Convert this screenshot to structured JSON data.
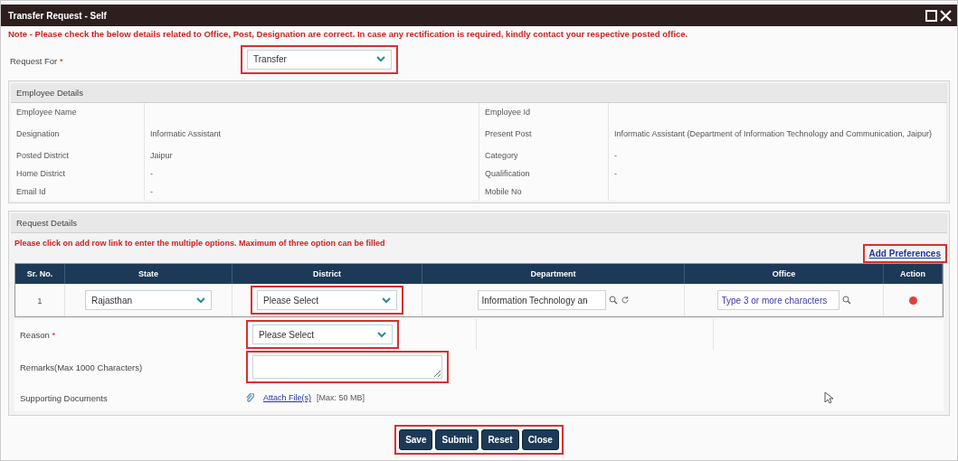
{
  "window": {
    "title": "Transfer Request - Self"
  },
  "note": "Note - Please check the below details related to Office, Post, Designation are correct. In case any rectification is required, kindly contact your respective posted office.",
  "request_for": {
    "label": "Request For",
    "required": true,
    "required_mark": "*",
    "value": "Transfer",
    "highlighted": true
  },
  "employee_details": {
    "title": "Employee Details",
    "rows": [
      {
        "left": {
          "label": "Employee Name"
        },
        "right": {
          "label": "Employee Id"
        }
      },
      {
        "left": {
          "label": "Designation",
          "value": "Informatic Assistant"
        },
        "right": {
          "label": "Present Post",
          "value": "Informatic Assistant (Department of Information Technology and Communication, Jaipur)"
        }
      },
      {
        "left": {
          "label": "Posted District",
          "value": "Jaipur"
        },
        "right": {
          "label": "Category",
          "value": "-"
        }
      },
      {
        "left": {
          "label": "Home District",
          "value": "-"
        },
        "right": {
          "label": "Qualification",
          "value": "-"
        }
      },
      {
        "left": {
          "label": "Email Id",
          "value": "-"
        },
        "right": {
          "label": "Mobile No"
        }
      }
    ]
  },
  "request_details": {
    "title": "Request Details",
    "instruction": "Please click on add row link to enter the multiple options. Maximum of three option can be filled",
    "add_link": {
      "label": "Add Preferences",
      "highlighted": true
    },
    "columns": [
      "Sr. No.",
      "State",
      "District",
      "Department",
      "Office",
      "Action"
    ],
    "rows": [
      {
        "sr": "1",
        "state": "Rajasthan",
        "district": {
          "value": "Please Select",
          "highlighted": true
        },
        "department": "Information Technology an",
        "office_placeholder": "Type 3 or more characters"
      }
    ]
  },
  "reason": {
    "label": "Reason",
    "required": true,
    "required_mark": "*",
    "value": "Please Select",
    "highlighted": true
  },
  "remarks": {
    "label": "Remarks(Max 1000 Characters)",
    "highlighted": true
  },
  "documents": {
    "label": "Supporting Documents",
    "link": "Attach File(s)",
    "limit": "[Max: 50 MB]"
  },
  "buttons": [
    "Save",
    "Submit",
    "Reset",
    "Close"
  ],
  "buttons_highlighted": true
}
